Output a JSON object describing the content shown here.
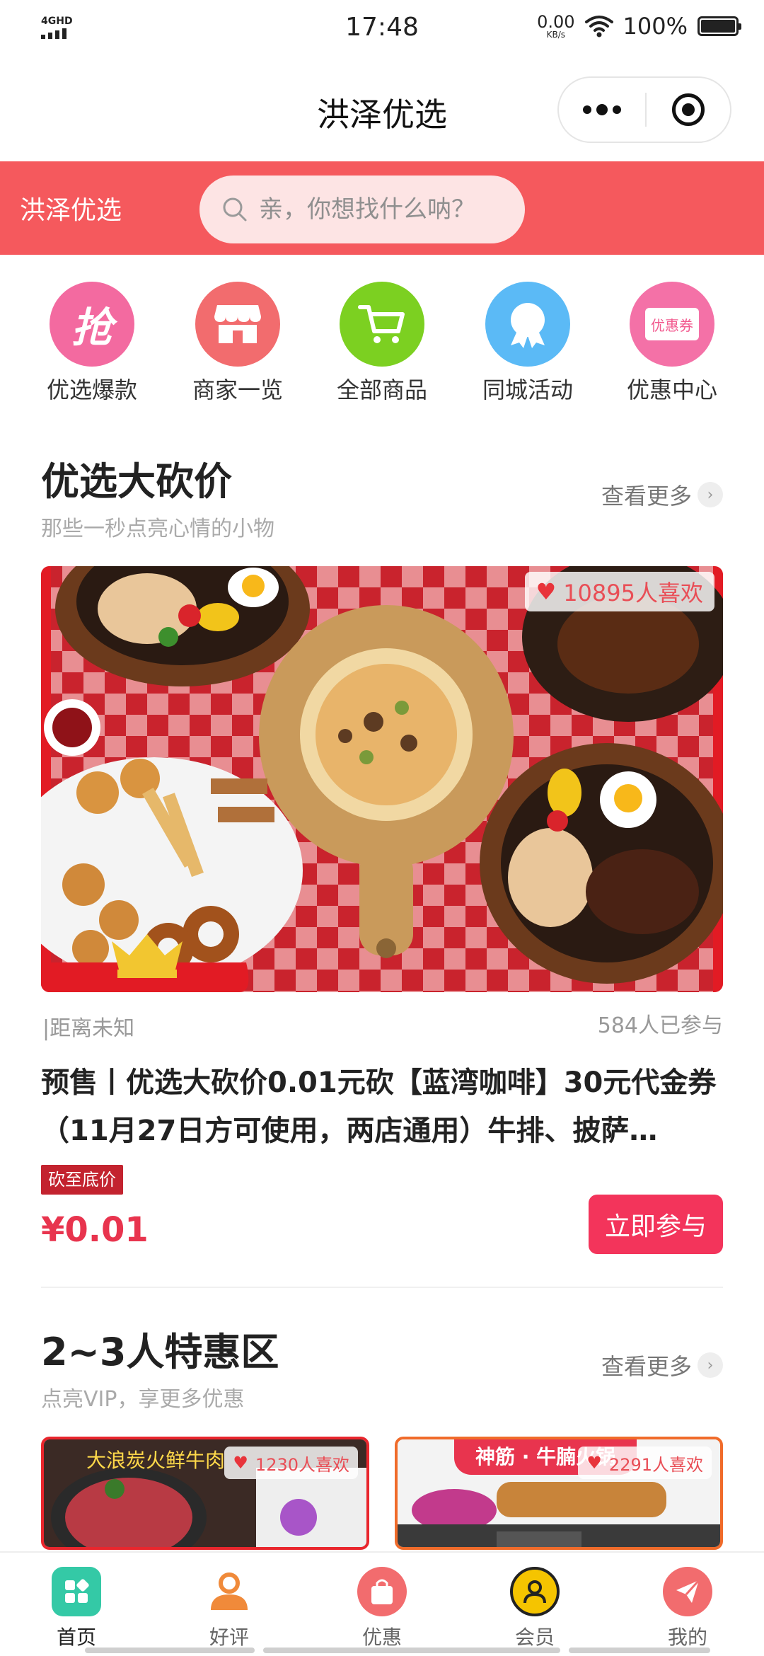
{
  "status_bar": {
    "network": "4GHD",
    "time": "17:48",
    "speed_value": "0.00",
    "speed_unit": "KB/s",
    "battery": "100%"
  },
  "nav": {
    "title": "洪泽优选"
  },
  "search": {
    "brand": "洪泽优选",
    "placeholder": "亲，你想找什么呐？"
  },
  "categories": [
    {
      "label": "优选爆款",
      "icon": "grab-icon",
      "color": "#f36aa0"
    },
    {
      "label": "商家一览",
      "icon": "store-icon",
      "color": "#f26c6e"
    },
    {
      "label": "全部商品",
      "icon": "cart-icon",
      "color": "#7cd021"
    },
    {
      "label": "同城活动",
      "icon": "ribbon-icon",
      "color": "#5bbaf6"
    },
    {
      "label": "优惠中心",
      "icon": "coupon-icon",
      "color": "#f471a7"
    }
  ],
  "section1": {
    "title": "优选大砍价",
    "subtitle": "那些一秒点亮心情的小物",
    "more": "查看更多",
    "likes": "10895人喜欢",
    "distance": "|距离未知",
    "participants": "584人已参与",
    "deal_title": "预售丨优选大砍价0.01元砍【蓝湾咖啡】30元代金券（11月27日方可使用，两店通用）牛排、披萨…",
    "tag": "砍至底价",
    "price": "¥0.01",
    "cta": "立即参与"
  },
  "section2": {
    "title": "2~3人特惠区",
    "subtitle": "点亮VIP，享更多优惠",
    "more": "查看更多",
    "cards": [
      {
        "banner": "大浪炭火鲜牛肉",
        "likes": "1230人喜欢"
      },
      {
        "banner": "神筋 · 牛腩火锅",
        "likes": "2291人喜欢"
      }
    ]
  },
  "tabs": [
    {
      "label": "首页",
      "icon": "home-grid-icon",
      "color": "#34c9a6"
    },
    {
      "label": "好评",
      "icon": "person-icon",
      "color": "#f08a3a"
    },
    {
      "label": "优惠",
      "icon": "bag-icon",
      "color": "#f26c6e"
    },
    {
      "label": "会员",
      "icon": "member-icon",
      "color": "#f5c400"
    },
    {
      "label": "我的",
      "icon": "send-icon",
      "color": "#f26c6e"
    }
  ]
}
